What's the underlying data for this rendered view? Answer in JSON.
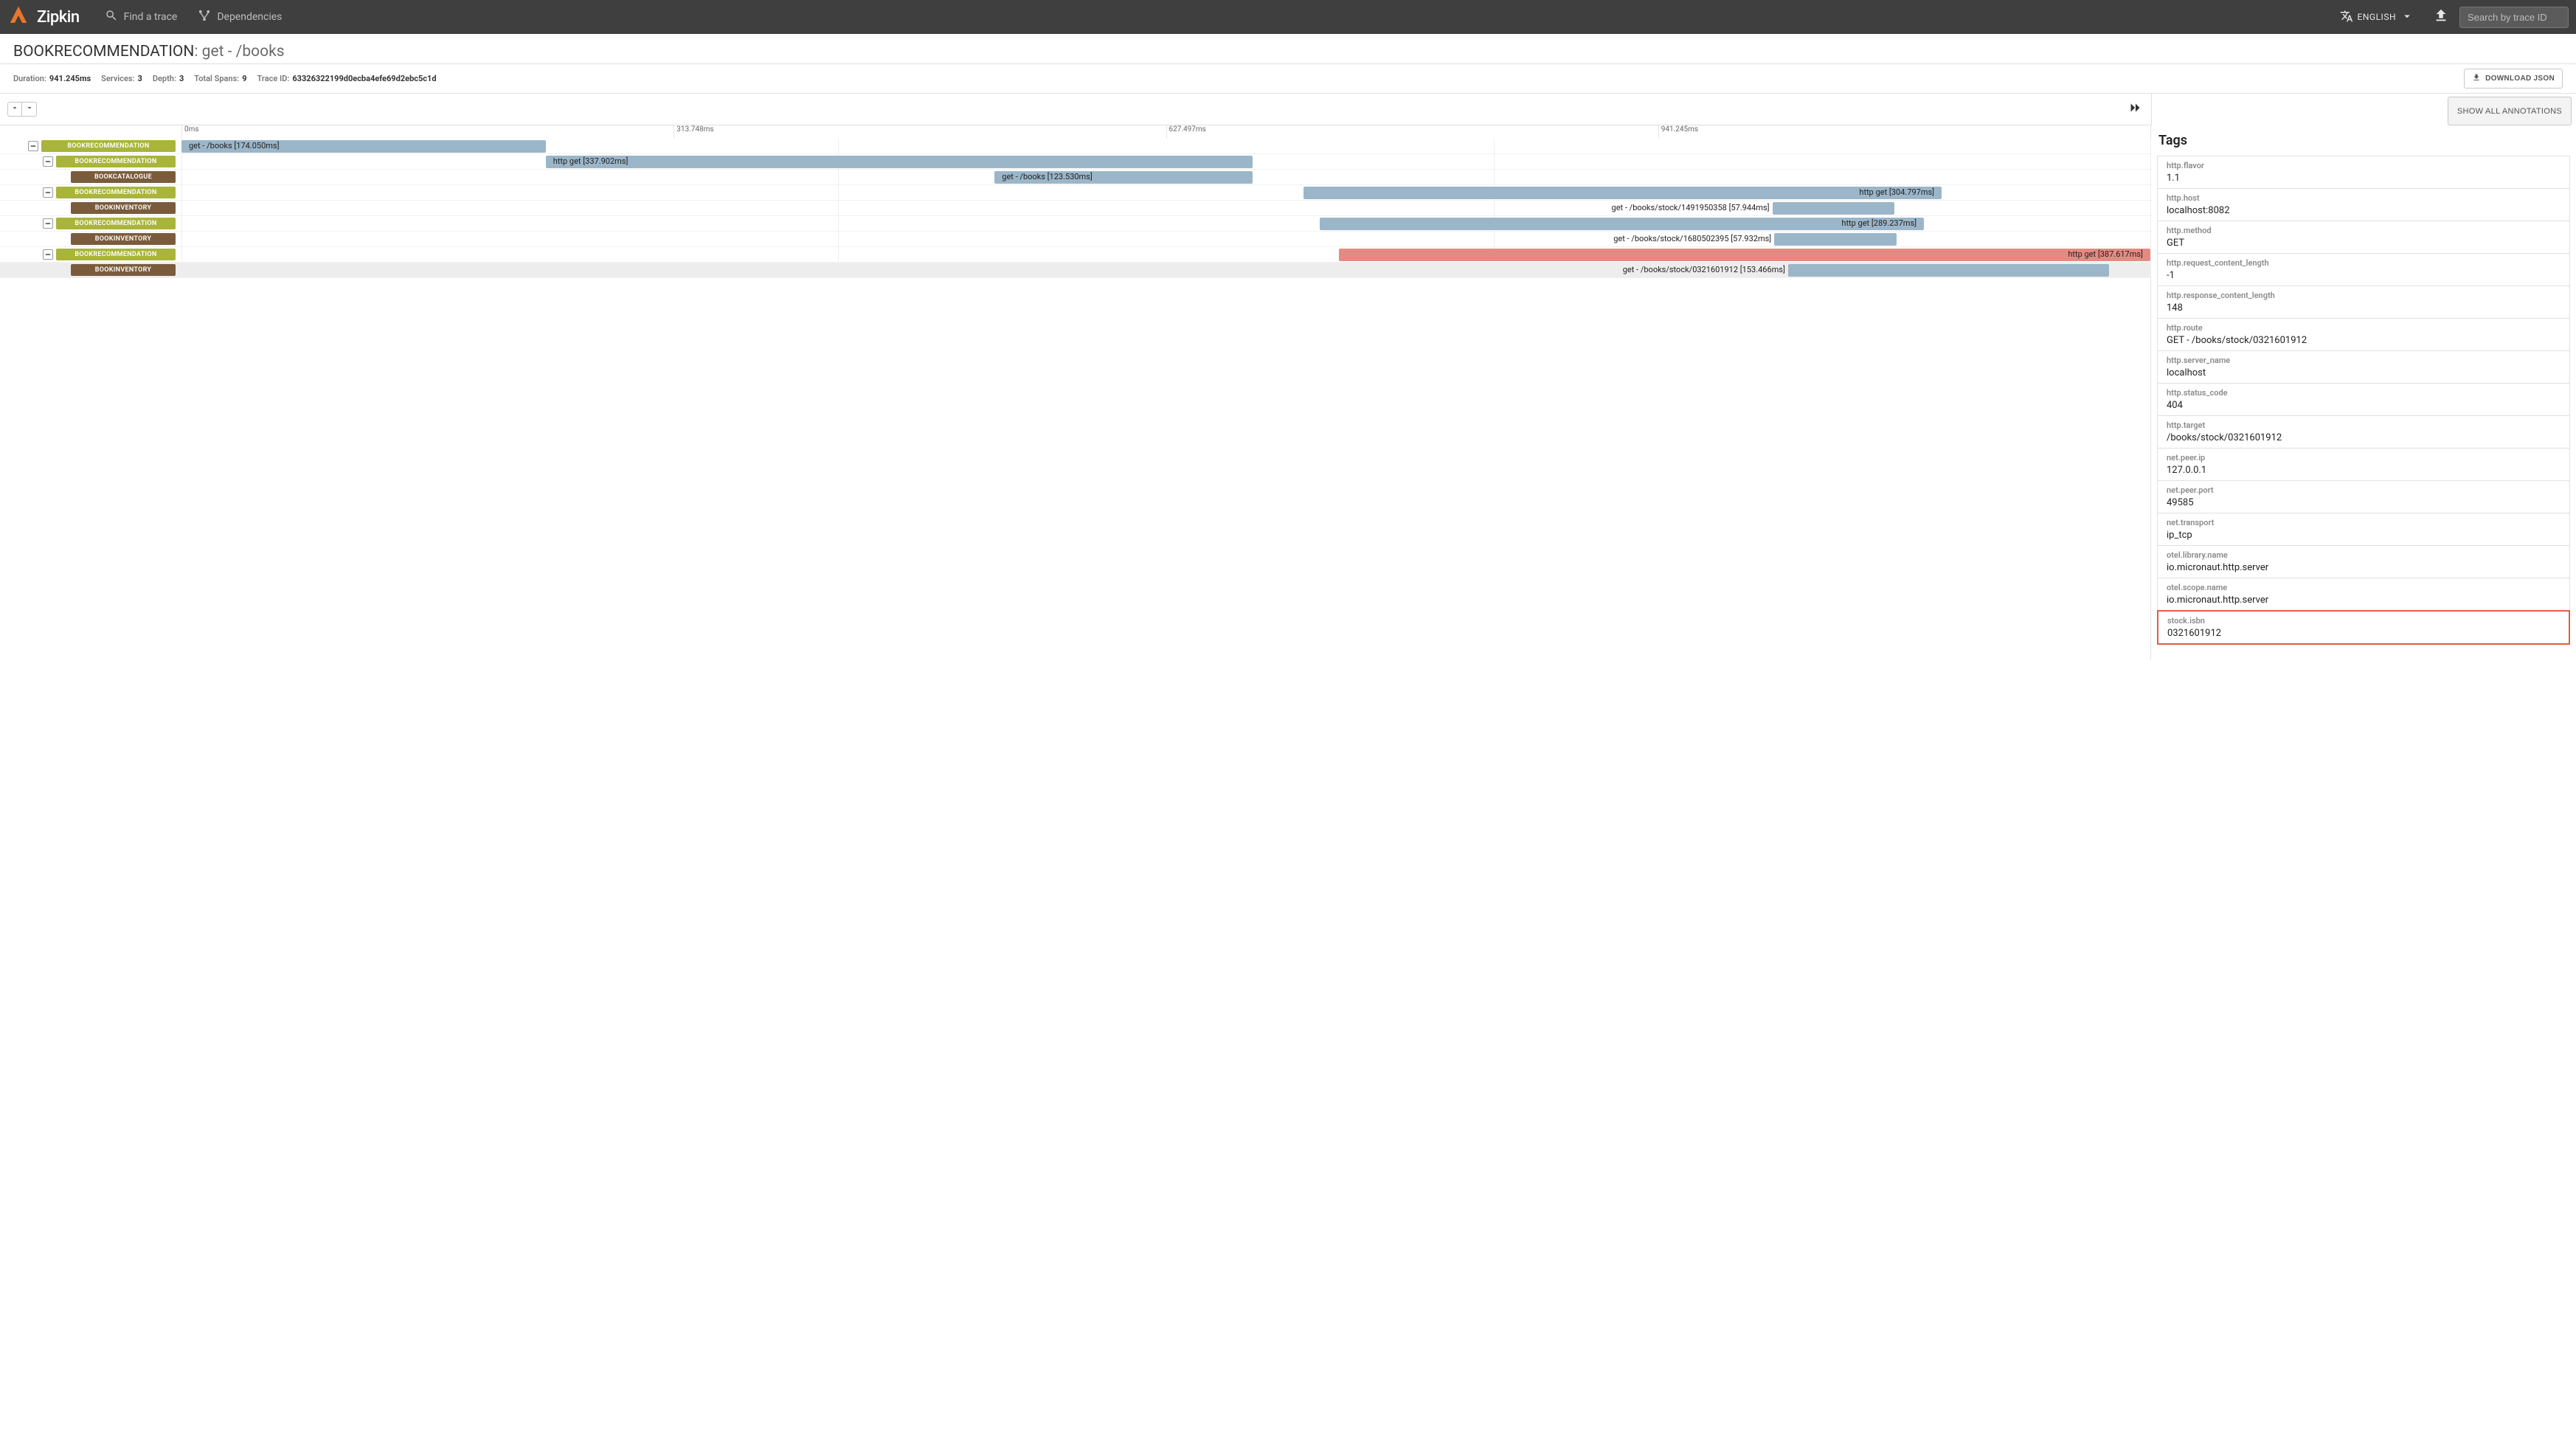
{
  "brand": "Zipkin",
  "nav": {
    "find": "Find a trace",
    "deps": "Dependencies"
  },
  "lang": "ENGLISH",
  "search_placeholder": "Search by trace ID",
  "title": {
    "service": "BOOKRECOMMENDATION",
    "op": ": get - /books"
  },
  "meta": {
    "duration_l": "Duration:",
    "duration_v": "941.245ms",
    "services_l": "Services:",
    "services_v": "3",
    "depth_l": "Depth:",
    "depth_v": "3",
    "spans_l": "Total Spans:",
    "spans_v": "9",
    "trace_l": "Trace ID:",
    "trace_v": "63326322199d0ecba4efe69d2ebc5c1d"
  },
  "download": "DOWNLOAD JSON",
  "show_all": "SHOW ALL ANNOTATIONS",
  "ticks": [
    "0ms",
    "313.748ms",
    "627.497ms",
    "941.245ms"
  ],
  "rows": [
    {
      "indent": 0,
      "toggle": true,
      "svc": "BOOKRECOMMENDATION",
      "cls": "svc-green",
      "bar": {
        "left": 0,
        "width": 18.5,
        "color": "bar-blue",
        "label": "get - /books [174.050ms]",
        "lpos": "in"
      },
      "sel": false
    },
    {
      "indent": 1,
      "toggle": true,
      "svc": "BOOKRECOMMENDATION",
      "cls": "svc-green",
      "bar": {
        "left": 18.5,
        "width": 35.9,
        "color": "bar-blue",
        "label": "http get [337.902ms]",
        "lpos": "in"
      },
      "sel": false
    },
    {
      "indent": 2,
      "toggle": false,
      "svc": "BOOKCATALOGUE",
      "cls": "svc-brown",
      "bar": {
        "left": 41.3,
        "width": 13.1,
        "color": "bar-blue",
        "label": "get - /books [123.530ms]",
        "lpos": "in"
      },
      "sel": false
    },
    {
      "indent": 1,
      "toggle": true,
      "svc": "BOOKRECOMMENDATION",
      "cls": "svc-green",
      "bar": {
        "left": 57.0,
        "width": 32.4,
        "color": "bar-blue",
        "label": "http get [304.797ms]",
        "lpos": "in-right"
      },
      "sel": false
    },
    {
      "indent": 2,
      "toggle": false,
      "svc": "BOOKINVENTORY",
      "cls": "svc-brown",
      "bar": {
        "left": 80.8,
        "width": 6.2,
        "color": "bar-blue",
        "label": "get - /books/stock/1491950358 [57.944ms]",
        "lpos": "left"
      },
      "sel": false
    },
    {
      "indent": 1,
      "toggle": true,
      "svc": "BOOKRECOMMENDATION",
      "cls": "svc-green",
      "bar": {
        "left": 57.8,
        "width": 30.7,
        "color": "bar-blue",
        "label": "http get [289.237ms]",
        "lpos": "in-right"
      },
      "sel": false
    },
    {
      "indent": 2,
      "toggle": false,
      "svc": "BOOKINVENTORY",
      "cls": "svc-brown",
      "bar": {
        "left": 80.9,
        "width": 6.2,
        "color": "bar-blue",
        "label": "get - /books/stock/1680502395 [57.932ms]",
        "lpos": "left"
      },
      "sel": false
    },
    {
      "indent": 1,
      "toggle": true,
      "svc": "BOOKRECOMMENDATION",
      "cls": "svc-green",
      "bar": {
        "left": 58.8,
        "width": 41.2,
        "color": "bar-red",
        "label": "http get [387.617ms]",
        "lpos": "in-right"
      },
      "sel": false
    },
    {
      "indent": 2,
      "toggle": false,
      "svc": "BOOKINVENTORY",
      "cls": "svc-brown",
      "bar": {
        "left": 81.6,
        "width": 16.3,
        "color": "bar-blue",
        "label": "get - /books/stock/0321601912 [153.466ms]",
        "lpos": "left"
      },
      "sel": true
    }
  ],
  "tags_title": "Tags",
  "tags": [
    {
      "k": "http.flavor",
      "v": "1.1"
    },
    {
      "k": "http.host",
      "v": "localhost:8082"
    },
    {
      "k": "http.method",
      "v": "GET"
    },
    {
      "k": "http.request_content_length",
      "v": "-1"
    },
    {
      "k": "http.response_content_length",
      "v": "148"
    },
    {
      "k": "http.route",
      "v": "GET - /books/stock/0321601912"
    },
    {
      "k": "http.server_name",
      "v": "localhost"
    },
    {
      "k": "http.status_code",
      "v": "404"
    },
    {
      "k": "http.target",
      "v": "/books/stock/0321601912"
    },
    {
      "k": "net.peer.ip",
      "v": "127.0.0.1"
    },
    {
      "k": "net.peer.port",
      "v": "49585"
    },
    {
      "k": "net.transport",
      "v": "ip_tcp"
    },
    {
      "k": "otel.library.name",
      "v": "io.micronaut.http.server"
    },
    {
      "k": "otel.scope.name",
      "v": "io.micronaut.http.server"
    },
    {
      "k": "stock.isbn",
      "v": "0321601912",
      "hilite": true
    }
  ]
}
